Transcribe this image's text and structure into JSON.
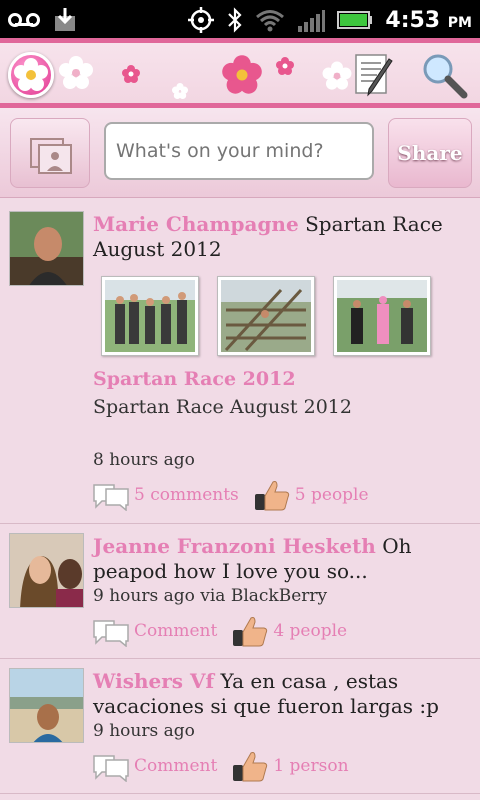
{
  "status_bar": {
    "time": "4:53",
    "ampm": "PM",
    "icons": [
      "voicemail-icon",
      "download-icon",
      "gps-icon",
      "bluetooth-icon",
      "wifi-icon",
      "signal-icon",
      "battery-icon"
    ]
  },
  "composer": {
    "placeholder": "What's on your mind?",
    "share_label": "Share"
  },
  "posts": [
    {
      "author": "Marie Champagne",
      "text": "Spartan Race August 2012",
      "album_title": "Spartan Race 2012",
      "album_desc": "Spartan Race August 2012",
      "time": "8 hours ago",
      "comments": "5 comments",
      "likes": "5 people"
    },
    {
      "author": "Jeanne Franzoni Hesketh",
      "text": "Oh peapod how I love you so...",
      "time": "9 hours ago via BlackBerry",
      "comments": "Comment",
      "likes": "4 people"
    },
    {
      "author": "Wishers Vf",
      "text": "Ya en casa , estas vacaciones si que fueron largas :p",
      "time": "9 hours ago",
      "comments": "Comment",
      "likes": "1 person"
    }
  ],
  "colors": {
    "accent": "#e0679a",
    "name": "#e57fb4",
    "background": "#f1dbe6"
  }
}
